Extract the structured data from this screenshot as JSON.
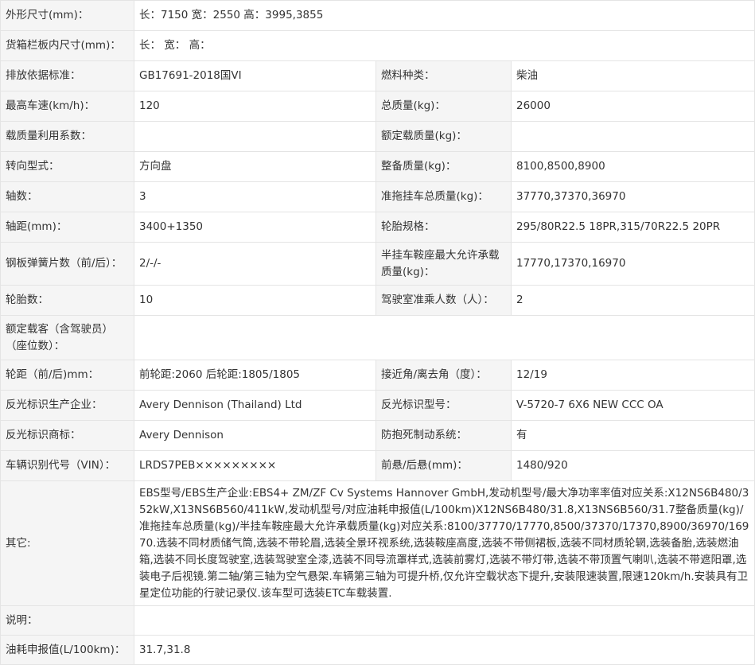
{
  "rows": [
    {
      "label": "外形尺寸(mm)：",
      "value": "长：7150 宽：2550 高：3995,3855"
    },
    {
      "label": "货箱栏板内尺寸(mm)：",
      "value": "长： 宽： 高："
    },
    {
      "label": "排放依据标准：",
      "value": "GB17691-2018国VI",
      "label2": "燃料种类：",
      "value2": "柴油"
    },
    {
      "label": "最高车速(km/h)：",
      "value": "120",
      "label2": "总质量(kg)：",
      "value2": "26000"
    },
    {
      "label": "载质量利用系数：",
      "value": "",
      "label2": "额定载质量(kg)：",
      "value2": ""
    },
    {
      "label": "转向型式：",
      "value": "方向盘",
      "label2": "整备质量(kg)：",
      "value2": "8100,8500,8900"
    },
    {
      "label": "轴数：",
      "value": "3",
      "label2": "准拖挂车总质量(kg)：",
      "value2": "37770,37370,36970"
    },
    {
      "label": "轴距(mm)：",
      "value": "3400+1350",
      "label2": "轮胎规格：",
      "value2": "295/80R22.5 18PR,315/70R22.5 20PR"
    },
    {
      "label": "钢板弹簧片数（前/后）：",
      "value": "2/-/-",
      "label2": "半挂车鞍座最大允许承载质量(kg)：",
      "value2": "17770,17370,16970"
    },
    {
      "label": "轮胎数：",
      "value": "10",
      "label2": "驾驶室准乘人数（人）：",
      "value2": "2"
    },
    {
      "label": "额定载客（含驾驶员）（座位数）：",
      "value": ""
    },
    {
      "label": "轮距（前/后)mm：",
      "value": "前轮距:2060 后轮距:1805/1805",
      "label2": "接近角/离去角（度）：",
      "value2": "12/19"
    },
    {
      "label": "反光标识生产企业：",
      "value": "Avery Dennison (Thailand) Ltd",
      "label2": "反光标识型号：",
      "value2": "V-5720-7 6X6 NEW CCC OA"
    },
    {
      "label": "反光标识商标：",
      "value": "Avery Dennison",
      "label2": "防抱死制动系统：",
      "value2": "有"
    },
    {
      "label": "车辆识别代号（VIN）：",
      "value": "LRDS7PEB×××××××××",
      "label2": "前悬/后悬(mm)：",
      "value2": "1480/920"
    },
    {
      "label": "其它:",
      "value": "EBS型号/EBS生产企业:EBS4+ ZM/ZF Cv Systems Hannover GmbH,发动机型号/最大净功率率值对应关系:X12NS6B480/352kW,X13NS6B560/411kW,发动机型号/对应油耗申报值(L/100km)X12NS6B480/31.8,X13NS6B560/31.7整备质量(kg)/准拖挂车总质量(kg)/半挂车鞍座最大允许承载质量(kg)对应关系:8100/37770/17770,8500/37370/17370,8900/36970/16970.选装不同材质储气筒,选装不带轮眉,选装全景环视系统,选装鞍座高度,选装不带侧裙板,选装不同材质轮辋,选装备胎,选装燃油箱,选装不同长度驾驶室,选装驾驶室全漆,选装不同导流罩样式,选装前雾灯,选装不带灯带,选装不带顶置气喇叭,选装不带遮阳罩,选装电子后视镜.第二轴/第三轴为空气悬架.车辆第三轴为可提升桥,仅允许空载状态下提升,安装限速装置,限速120km/h.安装具有卫星定位功能的行驶记录仪.该车型可选装ETC车载装置."
    },
    {
      "label": "说明：",
      "value": ""
    },
    {
      "label": "油耗申报值(L/100km)：",
      "value": "31.7,31.8"
    }
  ]
}
